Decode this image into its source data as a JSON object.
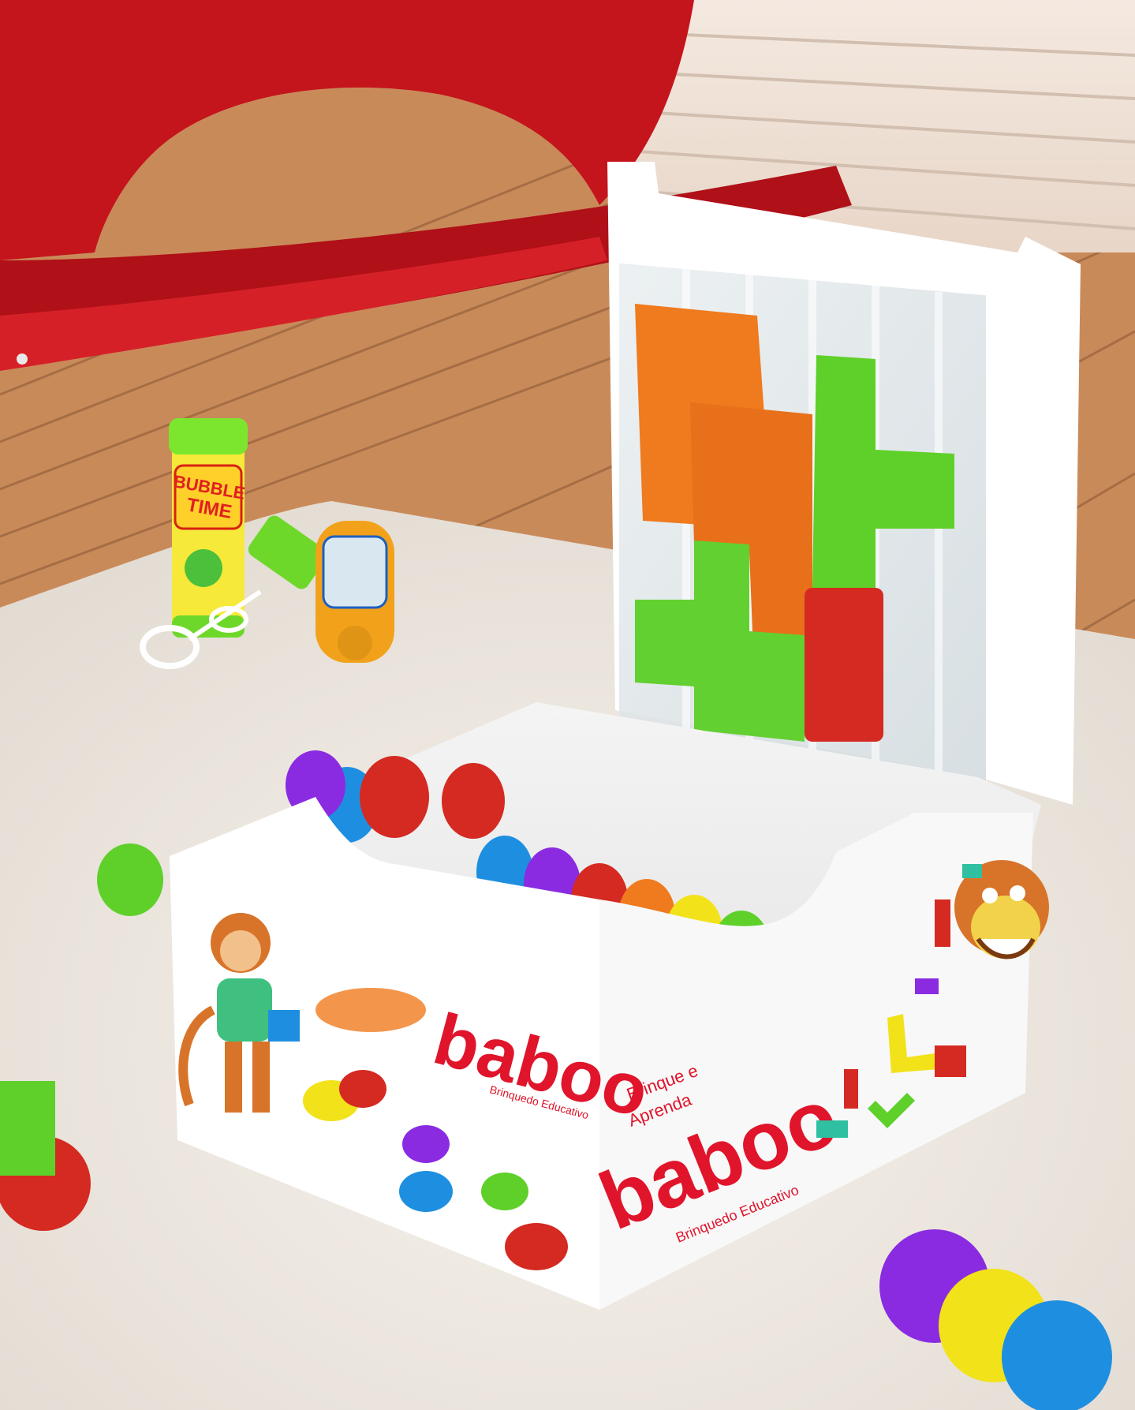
{
  "box_front": {
    "brand": "baboo",
    "subtitle": "Brinquedo Educativo"
  },
  "box_side": {
    "slogan_line1": "Brinque e",
    "slogan_line2": "Aprenda",
    "brand": "baboo",
    "subtitle": "Brinquedo Educativo"
  },
  "bubble_bottle": {
    "label_line1": "BUBBLE",
    "label_line2": "TIME"
  },
  "colors": {
    "brand_red": "#e0142a",
    "floor_wood": "#c98a5a",
    "rug": "#f2ede6",
    "rocking_horse_red": "#c4141c",
    "piece_orange": "#f07a1e",
    "piece_green": "#5fd02a",
    "piece_red": "#d42a22",
    "piece_purple": "#8a2be2",
    "piece_blue": "#1e8fe0",
    "piece_yellow": "#f2e21a"
  }
}
